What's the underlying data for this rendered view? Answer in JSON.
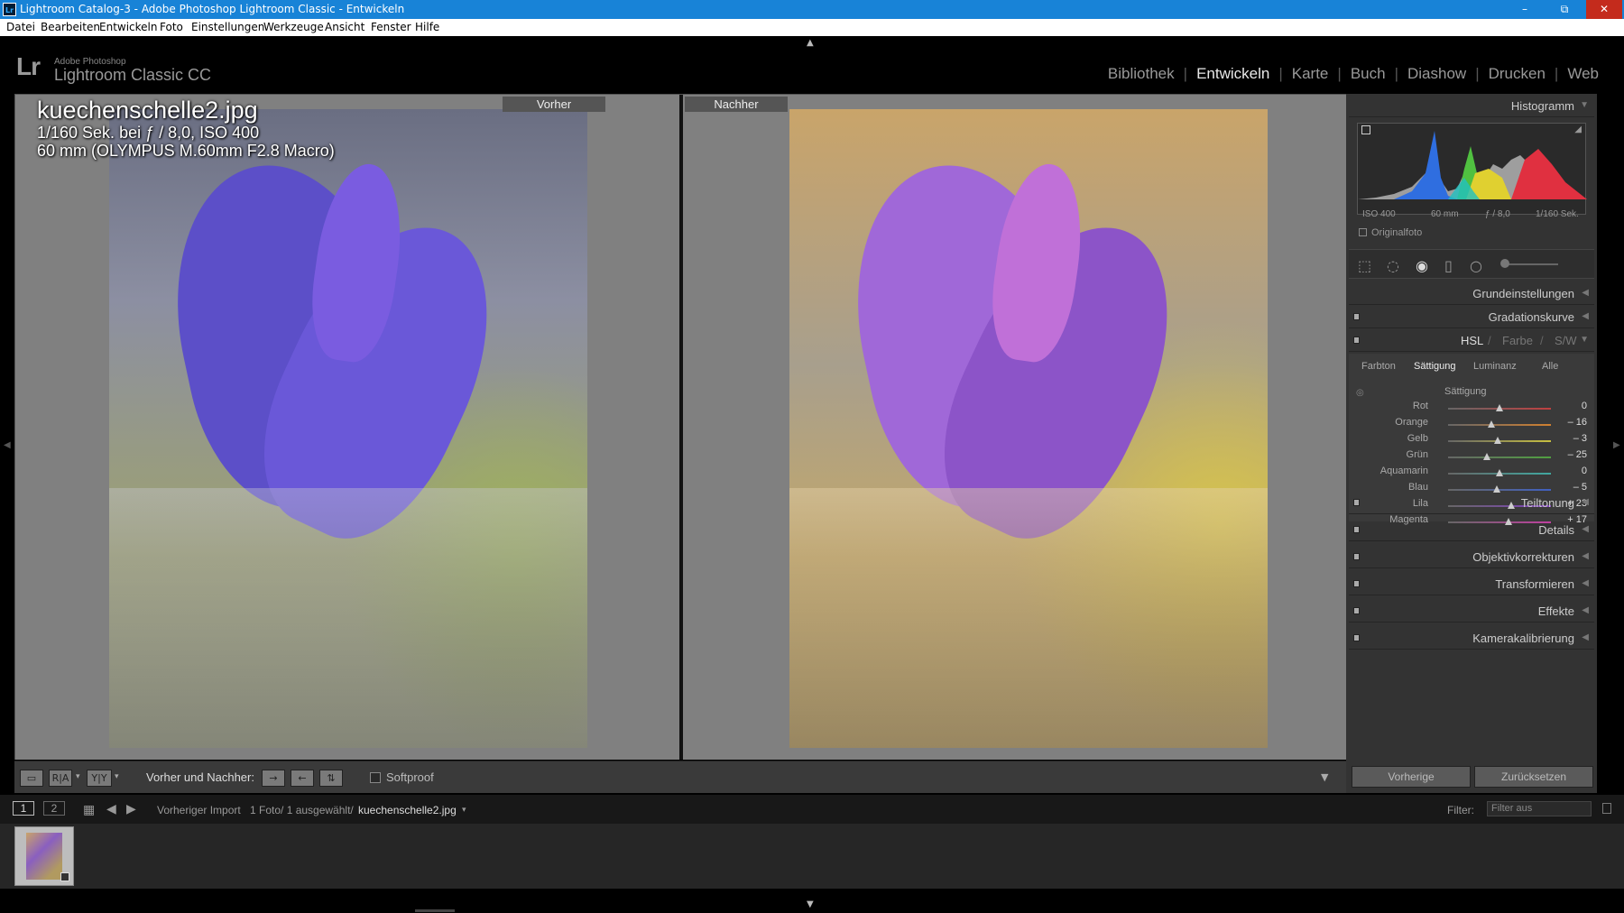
{
  "window": {
    "title": "Lightroom Catalog-3 - Adobe Photoshop Lightroom Classic - Entwickeln",
    "app_icon": "Lr",
    "minimize": "–",
    "maximize": "⧉",
    "close": "✕"
  },
  "menu": [
    "Datei",
    "Bearbeiten",
    "Entwickeln",
    "Foto",
    "Einstellungen",
    "Werkzeuge",
    "Ansicht",
    "Fenster",
    "Hilfe"
  ],
  "logo": {
    "mark": "Lr",
    "small": "Adobe Photoshop",
    "product": "Lightroom Classic CC"
  },
  "modules": [
    "Bibliothek",
    "Entwickeln",
    "Karte",
    "Buch",
    "Diashow",
    "Drucken",
    "Web"
  ],
  "active_module": "Entwickeln",
  "views": {
    "before": "Vorher",
    "after": "Nachher"
  },
  "photo_info": {
    "filename": "kuechenschelle2.jpg",
    "exposure": "1/160 Sek. bei ƒ / 8,0, ISO 400",
    "lens": "60 mm (OLYMPUS M.60mm F2.8 Macro)"
  },
  "toolbar": {
    "compare_label": "Vorher und Nachher:",
    "softproof": "Softproof"
  },
  "panels": {
    "histogram": {
      "title": "Histogramm",
      "iso": "ISO 400",
      "focal": "60 mm",
      "aperture": "ƒ / 8,0",
      "shutter": "1/160 Sek.",
      "original": "Originalfoto"
    },
    "sections_top": [
      "Grundeinstellungen",
      "Gradationskurve"
    ],
    "hsl": {
      "title": "HSL",
      "sep1": "/",
      "farbe": "Farbe",
      "sep2": "/",
      "sw": "S/W",
      "tabs": [
        "Farbton",
        "Sättigung",
        "Luminanz",
        "Alle"
      ],
      "active_tab": "Sättigung",
      "group": "Sättigung"
    },
    "sliders": [
      {
        "label": "Rot",
        "value": "0",
        "num": 0,
        "color": "#c04040"
      },
      {
        "label": "Orange",
        "value": "– 16",
        "num": -16,
        "color": "#d08030"
      },
      {
        "label": "Gelb",
        "value": "– 3",
        "num": -3,
        "color": "#c8c040"
      },
      {
        "label": "Grün",
        "value": "– 25",
        "num": -25,
        "color": "#50a040"
      },
      {
        "label": "Aquamarin",
        "value": "0",
        "num": 0,
        "color": "#40a8a0"
      },
      {
        "label": "Blau",
        "value": "– 5",
        "num": -5,
        "color": "#4060c0"
      },
      {
        "label": "Lila",
        "value": "+ 23",
        "num": 23,
        "color": "#8040c0"
      },
      {
        "label": "Magenta",
        "value": "+ 17",
        "num": 17,
        "color": "#c040a0"
      }
    ],
    "sections_bottom": [
      "Teiltonung",
      "Details",
      "Objektivkorrekturen",
      "Transformieren",
      "Effekte",
      "Kamerakalibrierung"
    ]
  },
  "buttons": {
    "previous": "Vorherige",
    "reset": "Zurücksetzen"
  },
  "filmbar": {
    "page1": "1",
    "page2": "2",
    "source": "Vorheriger Import",
    "count": "1 Foto/ 1 ausgewählt/",
    "filename": "kuechenschelle2.jpg",
    "filter_label": "Filter:",
    "filter_value": "Filter aus"
  }
}
